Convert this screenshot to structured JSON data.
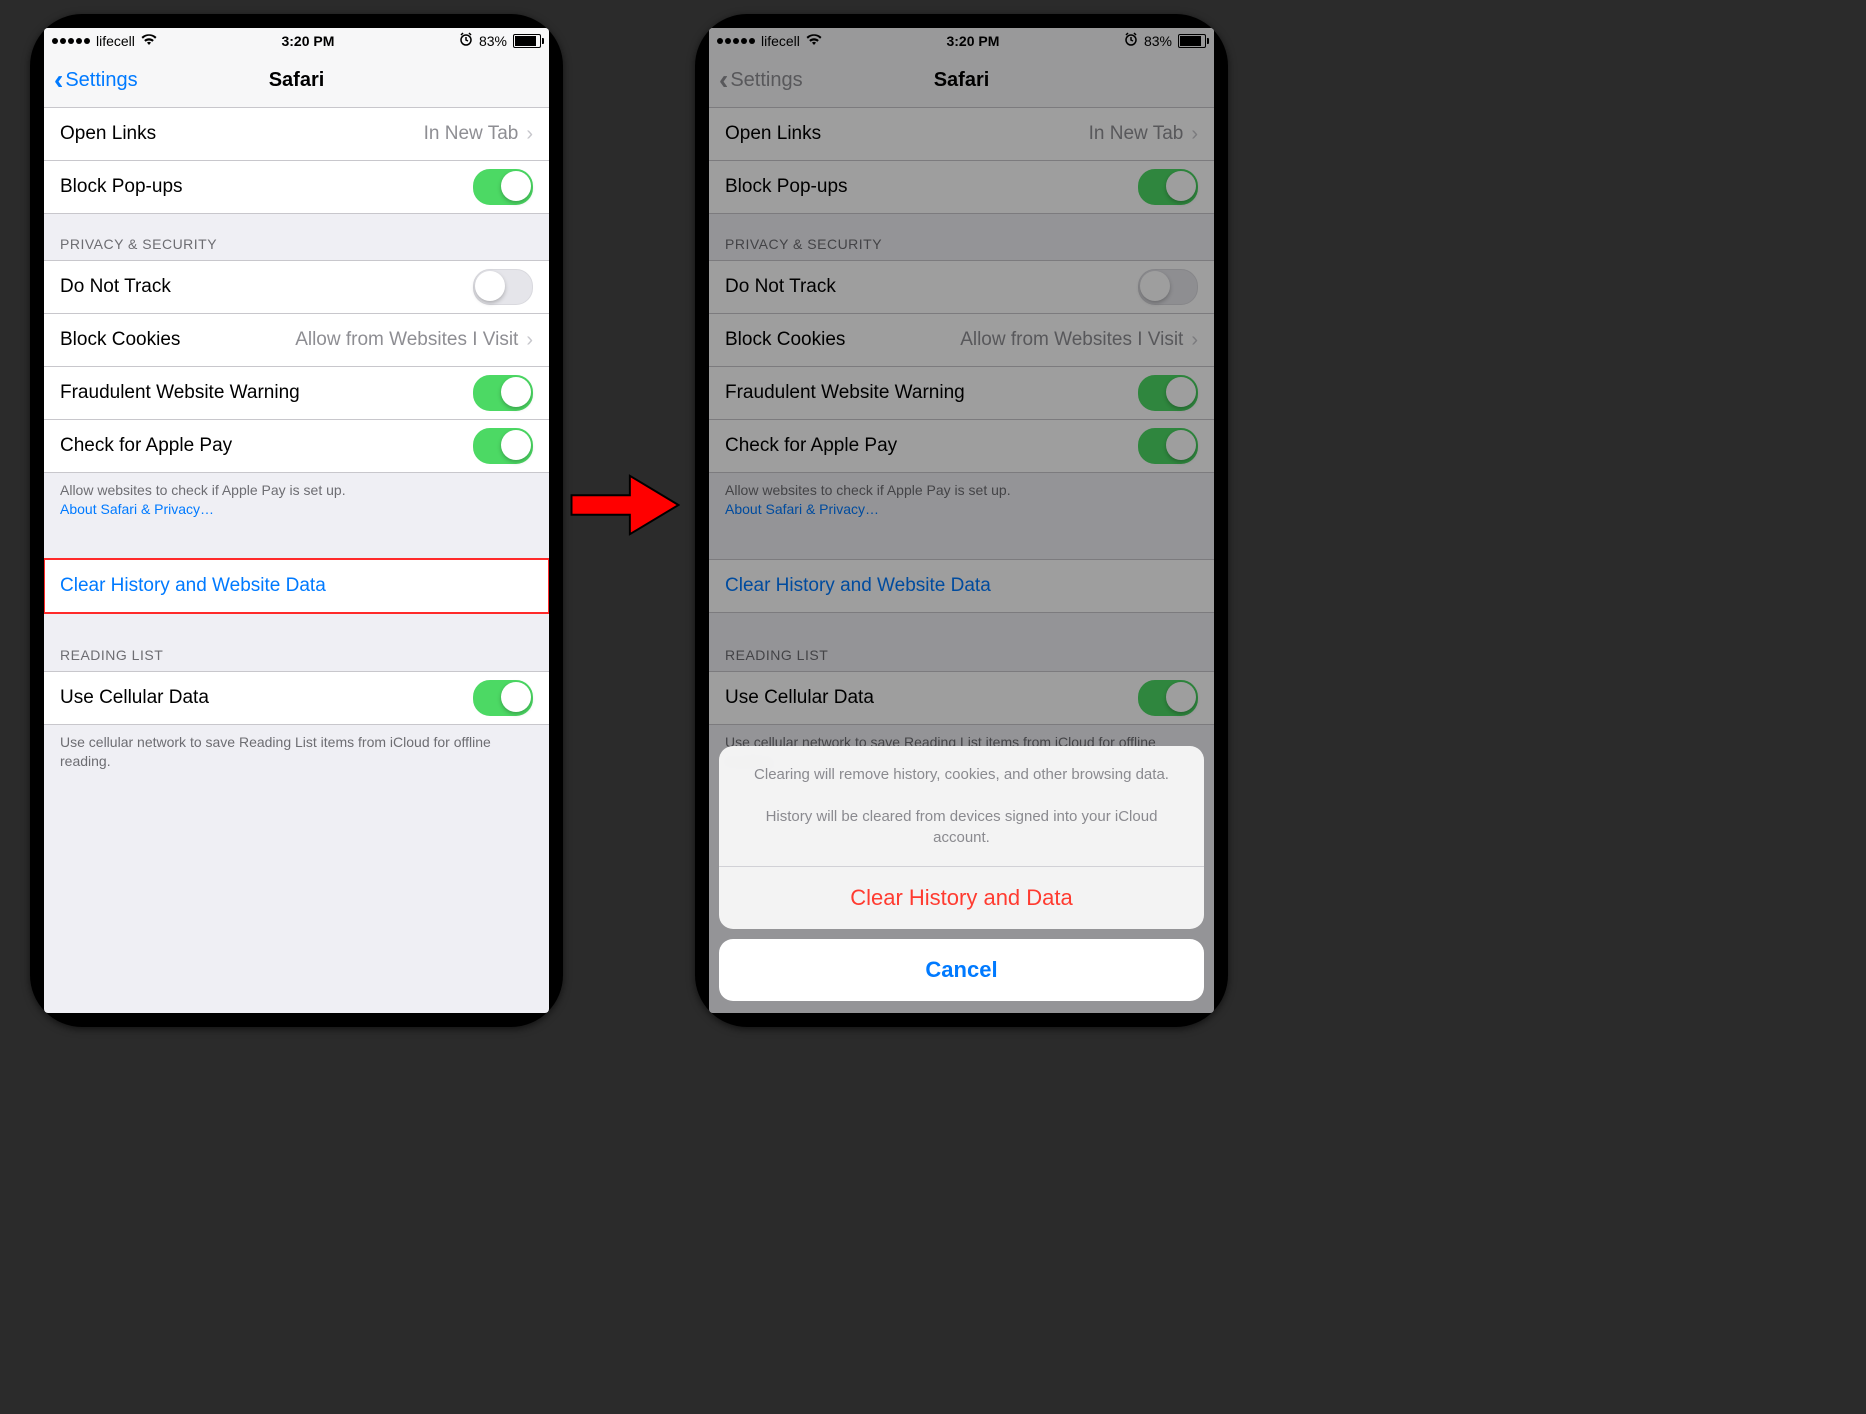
{
  "status": {
    "carrier": "lifecell",
    "time": "3:20 PM",
    "battery_pct": "83%",
    "alarm_icon": "alarm-icon",
    "wifi_icon": "wifi-icon"
  },
  "nav": {
    "back_label": "Settings",
    "title": "Safari"
  },
  "general": {
    "open_links_label": "Open Links",
    "open_links_value": "In New Tab",
    "block_popups_label": "Block Pop-ups",
    "block_popups_on": true
  },
  "privacy": {
    "header": "PRIVACY & SECURITY",
    "do_not_track_label": "Do Not Track",
    "do_not_track_on": false,
    "block_cookies_label": "Block Cookies",
    "block_cookies_value": "Allow from Websites I Visit",
    "fraud_label": "Fraudulent Website Warning",
    "fraud_on": true,
    "apple_pay_label": "Check for Apple Pay",
    "apple_pay_on": true,
    "footer_text": "Allow websites to check if Apple Pay is set up.",
    "footer_link": "About Safari & Privacy…"
  },
  "clear": {
    "label": "Clear History and Website Data"
  },
  "reading": {
    "header": "READING LIST",
    "cellular_label": "Use Cellular Data",
    "cellular_on": true,
    "footer": "Use cellular network to save Reading List items from iCloud for offline reading."
  },
  "sheet": {
    "message1": "Clearing will remove history, cookies, and other browsing data.",
    "message2": "History will be cleared from devices signed into your iCloud account.",
    "clear_action": "Clear History and Data",
    "cancel": "Cancel"
  }
}
